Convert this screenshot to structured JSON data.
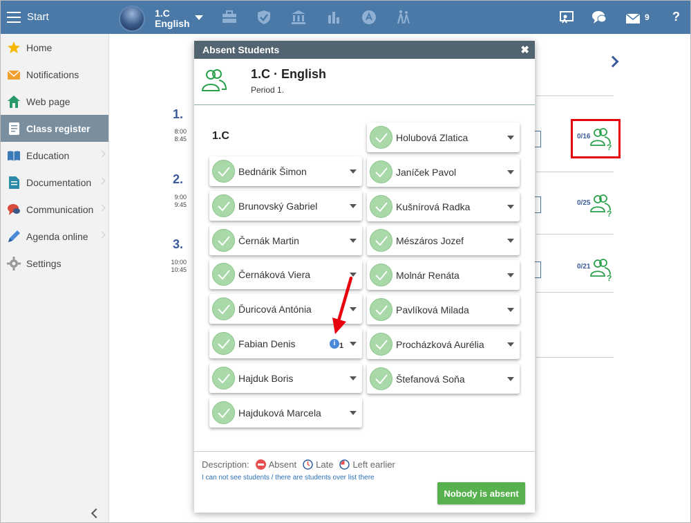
{
  "topbar": {
    "start_label": "Start",
    "class_label": "1.C",
    "subject_label": "English",
    "message_count": "9",
    "help_label": "?"
  },
  "sidebar": {
    "items": [
      {
        "label": "Home",
        "icon": "star-icon"
      },
      {
        "label": "Notifications",
        "icon": "envelope-icon"
      },
      {
        "label": "Web page",
        "icon": "house-icon"
      },
      {
        "label": "Class register",
        "icon": "notebook-icon"
      },
      {
        "label": "Education",
        "icon": "book-icon"
      },
      {
        "label": "Documentation",
        "icon": "document-icon"
      },
      {
        "label": "Communication",
        "icon": "chat-icon"
      },
      {
        "label": "Agenda online",
        "icon": "pen-icon"
      },
      {
        "label": "Settings",
        "icon": "gear-icon"
      }
    ]
  },
  "periods": [
    {
      "num": "1.",
      "start": "8:00",
      "end": "8:45",
      "count": "0/16"
    },
    {
      "num": "2.",
      "start": "9:00",
      "end": "9:45",
      "count": "0/25"
    },
    {
      "num": "3.",
      "start": "10:00",
      "end": "10:45",
      "count": "0/21"
    }
  ],
  "modal": {
    "title": "Absent Students",
    "close": "✖",
    "header_title": "1.C · English",
    "header_period": "Period 1.",
    "class_name": "1.C",
    "students_left": [
      {
        "name": "Bednárik Šimon"
      },
      {
        "name": "Brunovský Gabriel"
      },
      {
        "name": "Černák Martin"
      },
      {
        "name": "Černáková Viera"
      },
      {
        "name": "Ďuricová Antónia"
      },
      {
        "name": "Fabian Denis",
        "info": "1"
      },
      {
        "name": "Hajduk Boris"
      },
      {
        "name": "Hajduková Marcela"
      }
    ],
    "students_right": [
      {
        "name": "Holubová Zlatica"
      },
      {
        "name": "Janíček Pavol"
      },
      {
        "name": "Kušnírová Radka"
      },
      {
        "name": "Mészáros Jozef"
      },
      {
        "name": "Molnár Renáta"
      },
      {
        "name": "Pavlíková Milada"
      },
      {
        "name": "Procházková Aurélia"
      },
      {
        "name": "Štefanová Soňa"
      }
    ],
    "description_label": "Description:",
    "legend_absent": "Absent",
    "legend_late": "Late",
    "legend_left": "Left earlier",
    "link_text": "I can not see students / there are students over list there",
    "nobody_button": "Nobody is absent"
  },
  "colors": {
    "topbar": "#4a79a8",
    "accent_green": "#56b14e",
    "highlight_red": "#e8000c"
  }
}
